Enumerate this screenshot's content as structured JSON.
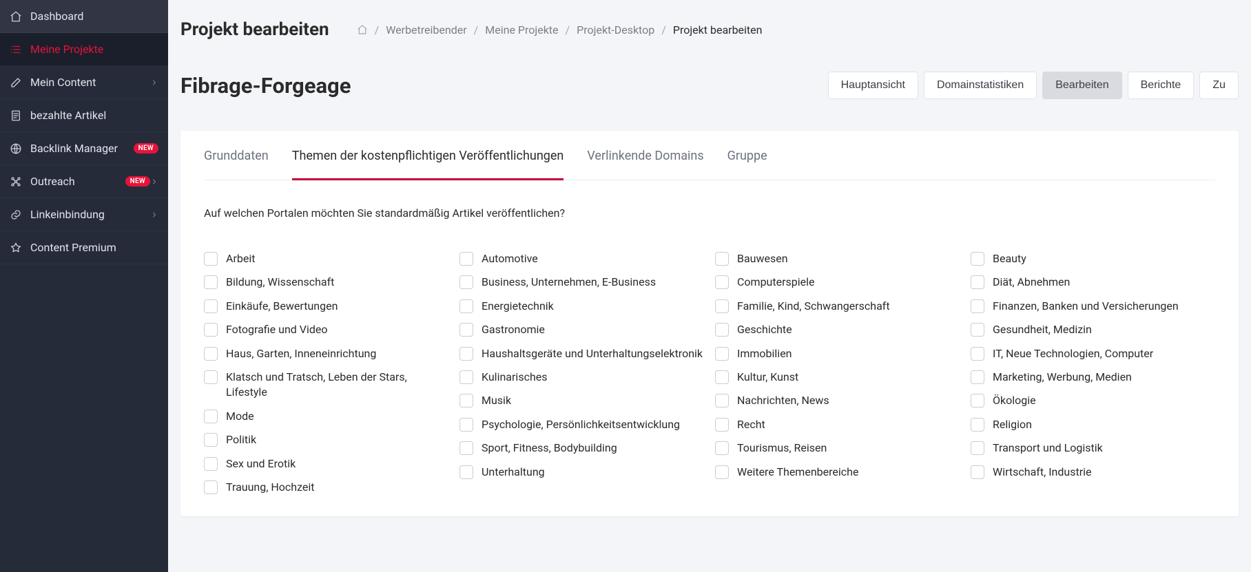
{
  "sidebar": {
    "items": [
      {
        "label": "Dashboard",
        "icon": "home",
        "active": false,
        "badge": null,
        "expandable": false
      },
      {
        "label": "Meine Projekte",
        "icon": "list",
        "active": true,
        "badge": null,
        "expandable": false
      },
      {
        "label": "Mein Content",
        "icon": "edit",
        "active": false,
        "badge": null,
        "expandable": true
      },
      {
        "label": "bezahlte Artikel",
        "icon": "receipt",
        "active": false,
        "badge": null,
        "expandable": false
      },
      {
        "label": "Backlink Manager",
        "icon": "globe",
        "active": false,
        "badge": "NEW",
        "expandable": false
      },
      {
        "label": "Outreach",
        "icon": "network",
        "active": false,
        "badge": "NEW",
        "expandable": true
      },
      {
        "label": "Linkeinbindung",
        "icon": "link",
        "active": false,
        "badge": null,
        "expandable": true
      },
      {
        "label": "Content Premium",
        "icon": "star",
        "active": false,
        "badge": null,
        "expandable": false
      }
    ]
  },
  "header": {
    "title": "Projekt bearbeiten",
    "breadcrumbs": [
      "Werbetreibender",
      "Meine Projekte",
      "Projekt-Desktop",
      "Projekt bearbeiten"
    ]
  },
  "project": {
    "name": "Fibrage-Forgeage",
    "action_buttons": [
      {
        "label": "Hauptansicht",
        "active": false
      },
      {
        "label": "Domainstatistiken",
        "active": false
      },
      {
        "label": "Bearbeiten",
        "active": true
      },
      {
        "label": "Berichte",
        "active": false
      },
      {
        "label": "Zu",
        "active": false
      }
    ]
  },
  "tabs": [
    {
      "label": "Grunddaten",
      "active": false
    },
    {
      "label": "Themen der kostenpflichtigen Veröffentlichungen",
      "active": true
    },
    {
      "label": "Verlinkende Domains",
      "active": false
    },
    {
      "label": "Gruppe",
      "active": false
    }
  ],
  "question": "Auf welchen Portalen möchten Sie standardmäßig Artikel veröffentlichen?",
  "topics": [
    [
      "Arbeit",
      "Automotive",
      "Bauwesen",
      "Beauty"
    ],
    [
      "Bildung, Wissenschaft",
      "Business, Unternehmen, E-Business",
      "Computerspiele",
      "Diät, Abnehmen"
    ],
    [
      "Einkäufe, Bewertungen",
      "Energietechnik",
      "Familie, Kind, Schwangerschaft",
      "Finanzen, Banken und Versicherungen"
    ],
    [
      "Fotografie und Video",
      "Gastronomie",
      "Geschichte",
      "Gesundheit, Medizin"
    ],
    [
      "Haus, Garten, Inneneinrichtung",
      "Haushaltsgeräte und Unterhaltungselektronik",
      "Immobilien",
      "IT, Neue Technologien, Computer"
    ],
    [
      "Klatsch und Tratsch, Leben der Stars, Lifestyle",
      "Kulinarisches",
      "Kultur, Kunst",
      "Marketing, Werbung, Medien"
    ],
    [
      "Mode",
      "Musik",
      "Nachrichten, News",
      "Ökologie"
    ],
    [
      "Politik",
      "Psychologie, Persönlichkeitsentwicklung",
      "Recht",
      "Religion"
    ],
    [
      "Sex und Erotik",
      "Sport, Fitness, Bodybuilding",
      "Tourismus, Reisen",
      "Transport und Logistik"
    ],
    [
      "Trauung, Hochzeit",
      "Unterhaltung",
      "Weitere Themenbereiche",
      "Wirtschaft, Industrie"
    ]
  ]
}
